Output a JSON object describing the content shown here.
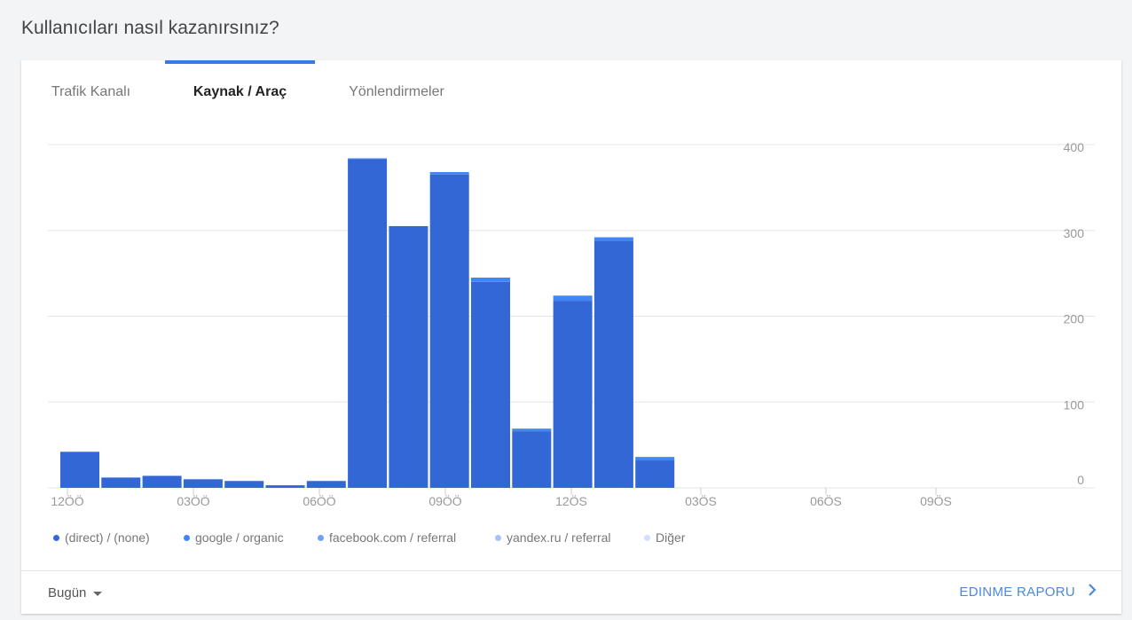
{
  "page": {
    "title": "Kullanıcıları nasıl kazanırsınız?"
  },
  "tabs": [
    {
      "label": "Trafik Kanalı",
      "active": false
    },
    {
      "label": "Kaynak / Araç",
      "active": true
    },
    {
      "label": "Yönlendirmeler",
      "active": false
    }
  ],
  "colors": {
    "accent": "#3b78e7",
    "direct": "#3367d6",
    "google": "#4285f4",
    "facebook": "#70a1f7",
    "yandex": "#a7c4f9",
    "other": "#d2e0fc"
  },
  "chart_data": {
    "type": "bar",
    "stacked": true,
    "x": [
      "12ÖÖ",
      "01ÖÖ",
      "02ÖÖ",
      "03ÖÖ",
      "04ÖÖ",
      "05ÖÖ",
      "06ÖÖ",
      "07ÖÖ",
      "08ÖÖ",
      "09ÖÖ",
      "10ÖÖ",
      "11ÖÖ",
      "12ÖS",
      "01ÖS",
      "02ÖS",
      "03ÖS",
      "04ÖS",
      "05ÖS",
      "06ÖS",
      "07ÖS",
      "08ÖS",
      "09ÖS",
      "10ÖS",
      "11ÖS"
    ],
    "tick_labels": [
      "12ÖÖ",
      "03ÖÖ",
      "06ÖÖ",
      "09ÖÖ",
      "12ÖS",
      "03ÖS",
      "06ÖS",
      "09ÖS"
    ],
    "y_ticks": [
      0,
      100,
      200,
      300,
      400
    ],
    "ylim": [
      0,
      400
    ],
    "grid": true,
    "legend_position": "bottom-left",
    "series": [
      {
        "name": "(direct) / (none)",
        "values": [
          42,
          12,
          14,
          10,
          8,
          3,
          8,
          383,
          305,
          365,
          240,
          66,
          218,
          288,
          32,
          0,
          0,
          0,
          0,
          0,
          0,
          0,
          0,
          0
        ]
      },
      {
        "name": "google / organic",
        "values": [
          0,
          0,
          0,
          0,
          0,
          0,
          0,
          1,
          0,
          3,
          5,
          3,
          6,
          4,
          4,
          0,
          0,
          0,
          0,
          0,
          0,
          0,
          0,
          0
        ]
      },
      {
        "name": "facebook.com / referral",
        "values": [
          0,
          0,
          0,
          0,
          0,
          0,
          0,
          0,
          0,
          0,
          0,
          0,
          0,
          0,
          0,
          0,
          0,
          0,
          0,
          0,
          0,
          0,
          0,
          0
        ]
      },
      {
        "name": "yandex.ru / referral",
        "values": [
          0,
          0,
          0,
          0,
          0,
          0,
          0,
          0,
          0,
          0,
          0,
          0,
          0,
          0,
          0,
          0,
          0,
          0,
          0,
          0,
          0,
          0,
          0,
          0
        ]
      },
      {
        "name": "Diğer",
        "values": [
          0,
          0,
          0,
          0,
          0,
          0,
          0,
          0,
          0,
          0,
          0,
          0,
          0,
          0,
          0,
          0,
          0,
          0,
          0,
          0,
          0,
          0,
          0,
          0
        ]
      }
    ]
  },
  "footer": {
    "date_range": "Bugün",
    "report_link": "EDINME RAPORU"
  }
}
